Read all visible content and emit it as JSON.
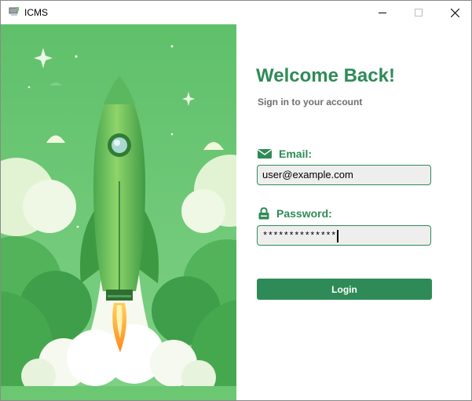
{
  "window": {
    "title": "ICMS"
  },
  "login": {
    "heading": "Welcome Back!",
    "subheading": "Sign in to your account",
    "email_label": "Email:",
    "email_value": "user@example.com",
    "password_label": "Password:",
    "password_masked": "**************",
    "login_label": "Login"
  },
  "colors": {
    "accent": "#2e8b57",
    "input_bg": "#eeeeee",
    "hero_bg": "#66c46c"
  },
  "icons": [
    "app-icon",
    "minimize-icon",
    "maximize-icon",
    "close-icon",
    "envelope-icon",
    "lock-icon"
  ]
}
